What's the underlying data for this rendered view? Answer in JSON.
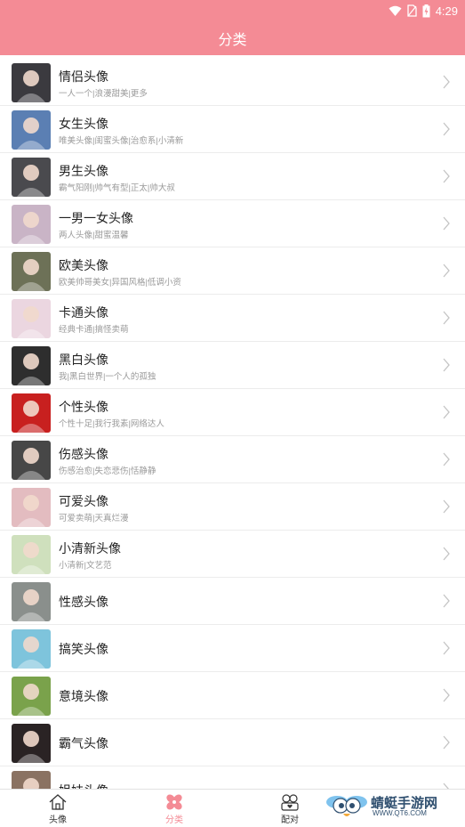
{
  "status_bar": {
    "time": "4:29"
  },
  "header": {
    "title": "分类"
  },
  "categories": [
    {
      "title": "情侣头像",
      "subtitle": "一人一个|浪漫甜美|更多",
      "thumb_color": "#3b3a3f"
    },
    {
      "title": "女生头像",
      "subtitle": "唯美头像|闺蜜头像|治愈系|小清新",
      "thumb_color": "#5b7fb3"
    },
    {
      "title": "男生头像",
      "subtitle": "霸气阳刚|帅气有型|正太|帅大叔",
      "thumb_color": "#4a4a4e"
    },
    {
      "title": "一男一女头像",
      "subtitle": "两人头像|甜蜜温馨",
      "thumb_color": "#c9b4c6"
    },
    {
      "title": "欧美头像",
      "subtitle": "欧美帅哥美女|异国风格|低调小资",
      "thumb_color": "#6d7157"
    },
    {
      "title": "卡通头像",
      "subtitle": "经典卡通|搞怪卖萌",
      "thumb_color": "#ebd6e0"
    },
    {
      "title": "黑白头像",
      "subtitle": "我|黑白世界|一个人的孤独",
      "thumb_color": "#2e2e2e"
    },
    {
      "title": "个性头像",
      "subtitle": "个性十足|我行我素|网络达人",
      "thumb_color": "#c8201f"
    },
    {
      "title": "伤感头像",
      "subtitle": "伤感治愈|失恋悲伤|恬静静",
      "thumb_color": "#474747"
    },
    {
      "title": "可爱头像",
      "subtitle": "可爱卖萌|天真烂漫",
      "thumb_color": "#e3bcc0"
    },
    {
      "title": "小清新头像",
      "subtitle": "小清新|文艺范",
      "thumb_color": "#cfe0bd"
    },
    {
      "title": "性感头像",
      "subtitle": "",
      "thumb_color": "#8a8f8c"
    },
    {
      "title": "搞笑头像",
      "subtitle": "",
      "thumb_color": "#7ec4dc"
    },
    {
      "title": "意境头像",
      "subtitle": "",
      "thumb_color": "#7aa24b"
    },
    {
      "title": "霸气头像",
      "subtitle": "",
      "thumb_color": "#2a2324"
    },
    {
      "title": "姐妹头像",
      "subtitle": "",
      "thumb_color": "#8a7262"
    }
  ],
  "tabbar": {
    "tabs": [
      {
        "label": "头像",
        "icon": "home-icon"
      },
      {
        "label": "分类",
        "icon": "flower-icon"
      },
      {
        "label": "配对",
        "icon": "pair-icon"
      }
    ],
    "active_color": "#f48b95"
  },
  "watermark": {
    "brand": "蜻蜓手游网",
    "url": "WWW.QT6.COM"
  },
  "colors": {
    "accent": "#f48b95"
  }
}
